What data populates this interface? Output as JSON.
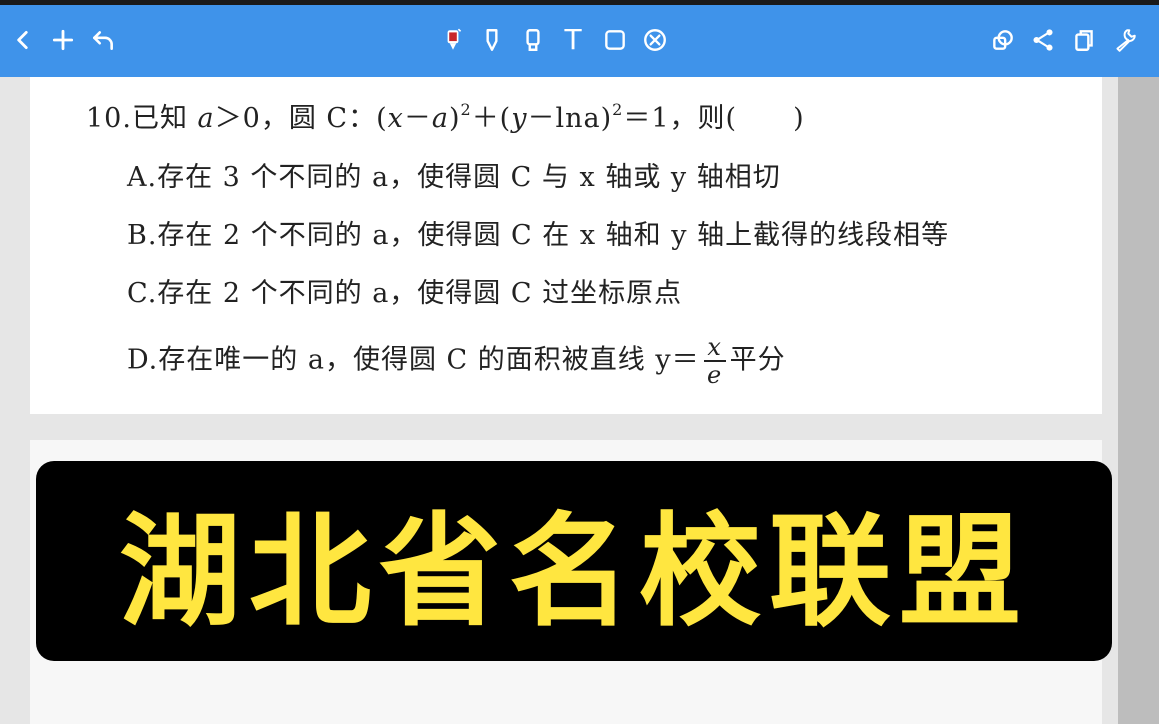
{
  "toolbar": {
    "left_icons": [
      "chevron-left-icon",
      "plus-icon",
      "undo-icon"
    ],
    "center_icons": [
      "marker-icon",
      "pen-icon",
      "highlighter-icon",
      "text-tool-icon",
      "shape-tool-icon",
      "eraser-icon"
    ],
    "right_icons": [
      "lasso-icon",
      "share-icon",
      "copy-icon",
      "wrench-icon"
    ],
    "text_tool_label": "T",
    "colors": {
      "toolbar_bg": "#3f93ea",
      "icon": "#ffffff",
      "marker": "#c8262a"
    }
  },
  "question": {
    "number": "10.",
    "stem_prefix": "已知",
    "stem_a": "a",
    "stem_gt0": "＞0，圆 C：(",
    "stem_x": "x",
    "stem_minus_a": "－",
    "stem_a2": "a",
    "stem_close1": ")",
    "sup1": "2",
    "stem_plus": "＋(",
    "stem_y": "y",
    "stem_minus_ln": "－lna",
    "stem_close2": ")",
    "sup2": "2",
    "stem_tail": "＝1，则(　　)",
    "option_a": "A.存在 3 个不同的 a，使得圆 C 与 x 轴或 y 轴相切",
    "option_b": "B.存在 2 个不同的 a，使得圆 C 在 x 轴和 y 轴上截得的线段相等",
    "option_c": "C.存在 2 个不同的 a，使得圆 C 过坐标原点",
    "option_d_prefix": "D.存在唯一的 a，使得圆 C 的面积被直线 y＝",
    "option_d_num": "x",
    "option_d_den": "e",
    "option_d_suffix": "平分"
  },
  "banner": {
    "text": "湖北省名校联盟",
    "colors": {
      "bg": "#000000",
      "text": "#ffe640"
    }
  }
}
